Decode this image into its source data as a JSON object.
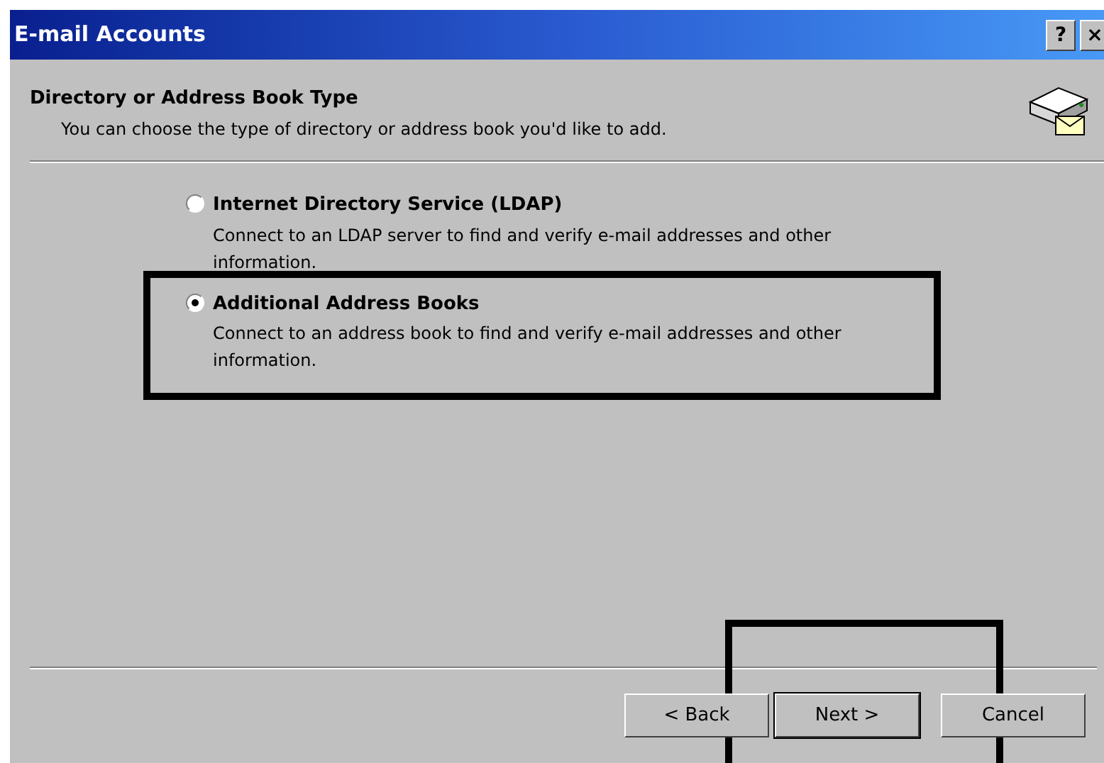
{
  "window": {
    "title": "E-mail Accounts",
    "title_buttons": [
      "?",
      "×"
    ]
  },
  "header": {
    "title": "Directory or Address Book Type",
    "subtitle": "You can choose the type of directory or address book you'd like to add."
  },
  "options": [
    {
      "label": "Internet Directory Service (LDAP)",
      "description": "Connect to an LDAP server to find and verify e-mail addresses and other information.",
      "selected": false
    },
    {
      "label": "Additional Address Books",
      "description": "Connect to an address book to find and verify e-mail addresses and other information.",
      "selected": true
    }
  ],
  "buttons": [
    {
      "label": "< Back",
      "default": false
    },
    {
      "label": "Next >",
      "default": true
    },
    {
      "label": "Cancel",
      "default": false
    }
  ]
}
